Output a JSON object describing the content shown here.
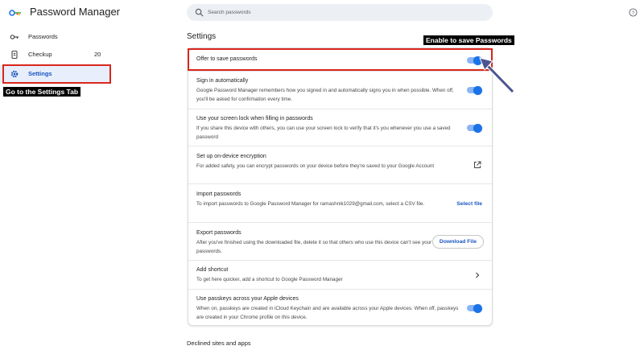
{
  "app": {
    "title": "Password Manager"
  },
  "search": {
    "placeholder": "Search passwords"
  },
  "sidebar": {
    "items": [
      {
        "label": "Passwords",
        "icon": "key-icon"
      },
      {
        "label": "Checkup",
        "icon": "checkup-icon",
        "count": "20"
      },
      {
        "label": "Settings",
        "icon": "gear-icon",
        "active": true
      }
    ]
  },
  "annotations": {
    "settings_caption": "Go to the Settings Tab",
    "offer_caption": "Enable to save Passwords",
    "highlight_color": "#d9261c"
  },
  "main": {
    "section_title": "Settings",
    "rows": [
      {
        "title": "Offer to save passwords",
        "desc": "",
        "control": "toggle",
        "on": true
      },
      {
        "title": "Sign in automatically",
        "desc": "Google Password Manager remembers how you signed in and automatically signs you in when possible. When off, you'll be asked for confirmation every time.",
        "control": "toggle",
        "on": true
      },
      {
        "title": "Use your screen lock when filling in passwords",
        "desc": "If you share this device with others, you can use your screen lock to verify that it's you whenever you use a saved password",
        "control": "toggle",
        "on": true
      },
      {
        "title": "Set up on-device encryption",
        "desc": "For added safety, you can encrypt passwords on your device before they're saved to your Google Account",
        "control": "external-link-icon"
      },
      {
        "title": "Import passwords",
        "desc": "To import passwords to Google Password Manager for ramashnik1029@gmail.com, select a CSV file.",
        "control": "button",
        "button_label": "Select file"
      },
      {
        "title": "Export passwords",
        "desc": "After you've finished using the downloaded file, delete it so that others who use this device can't see your passwords.",
        "control": "outline-button",
        "button_label": "Download File"
      },
      {
        "title": "Add shortcut",
        "desc": "To get here quicker, add a shortcut to Google Password Manager",
        "control": "chevron-right-icon"
      },
      {
        "title": "Use passkeys across your Apple devices",
        "desc": "When on, passkeys are created in iCloud Keychain and are available across your Apple devices. When off, passkeys are created in your Chrome profile on this device.",
        "control": "toggle",
        "on": true
      }
    ],
    "declined_title": "Declined sites and apps"
  },
  "colors": {
    "accent": "#1a73e8",
    "link": "#1a56c2",
    "active_nav_bg": "#e8eefb"
  }
}
